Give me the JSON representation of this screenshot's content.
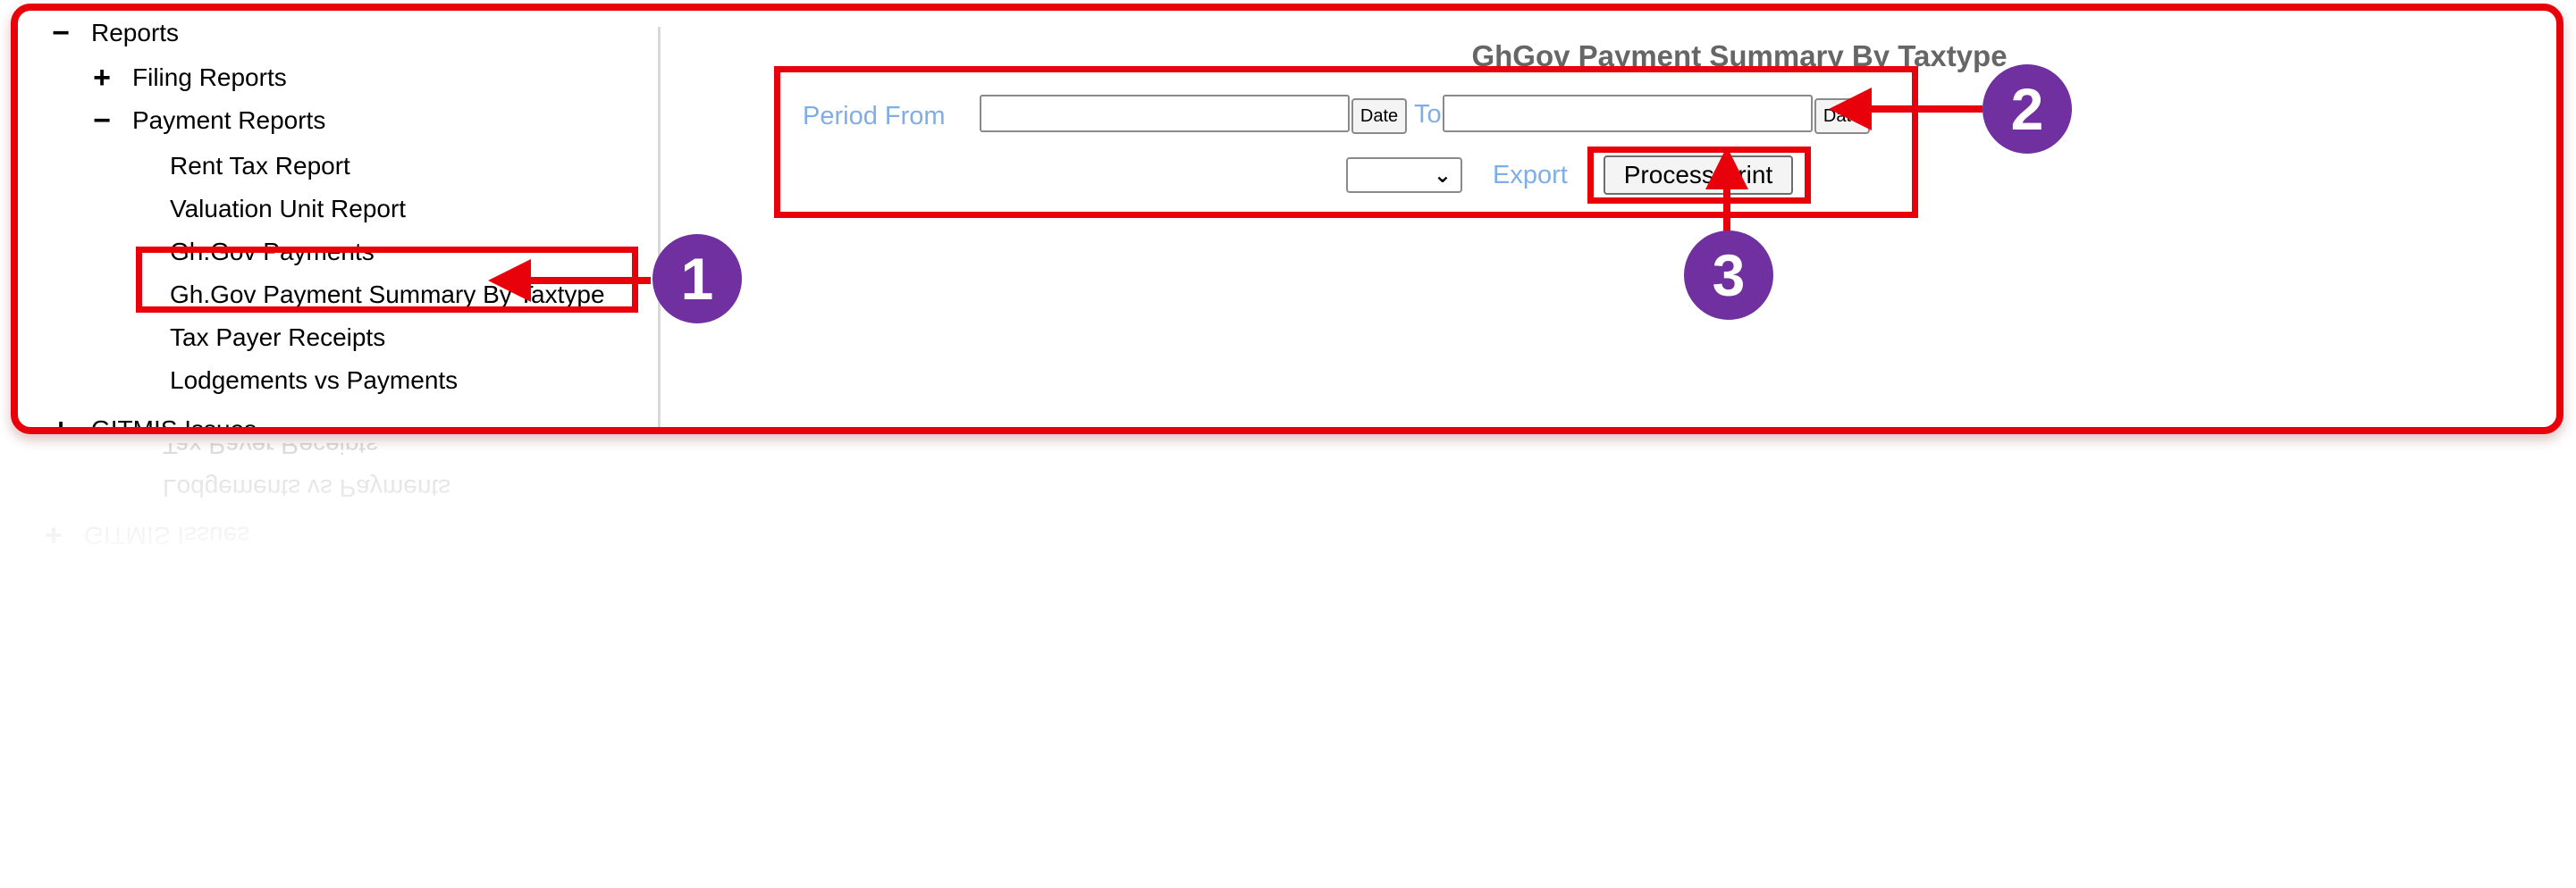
{
  "sidebar": {
    "items": [
      {
        "id": "reports",
        "icon": "minus-icon",
        "icon_glyph": "−",
        "label": "Reports"
      },
      {
        "id": "filing-reports",
        "icon": "plus-icon",
        "icon_glyph": "+",
        "label": "Filing Reports"
      },
      {
        "id": "payment-reports",
        "icon": "minus-icon",
        "icon_glyph": "−",
        "label": "Payment Reports"
      },
      {
        "id": "rent-tax-report",
        "label": "Rent Tax Report"
      },
      {
        "id": "valuation-unit-report",
        "label": "Valuation Unit Report"
      },
      {
        "id": "ghgov-payments",
        "label": "Gh.Gov Payments"
      },
      {
        "id": "ghgov-summary-by-taxtype",
        "label": "Gh.Gov Payment Summary By Taxtype"
      },
      {
        "id": "tax-payer-receipts",
        "label": "Tax Payer Receipts"
      },
      {
        "id": "lodgements-vs-payments",
        "label": "Lodgements vs Payments"
      },
      {
        "id": "gitmis-issues",
        "icon": "plus-icon",
        "icon_glyph": "+",
        "label": "GITMIS Issues"
      }
    ]
  },
  "main": {
    "title": "GhGov Payment Summary By Taxtype",
    "period_from_label": "Period From",
    "to_label": "To",
    "date_button_label": "Date",
    "period_from_value": "",
    "period_to_value": "",
    "export_selected": "",
    "export_label": "Export",
    "process_print_label": "Process Print"
  },
  "annotations": {
    "step1": "1",
    "step2": "2",
    "step3": "3"
  },
  "colors": {
    "highlight": "#e8000b",
    "badge": "#7030a0",
    "label_blue": "#7faee6",
    "title_gray": "#666666"
  }
}
